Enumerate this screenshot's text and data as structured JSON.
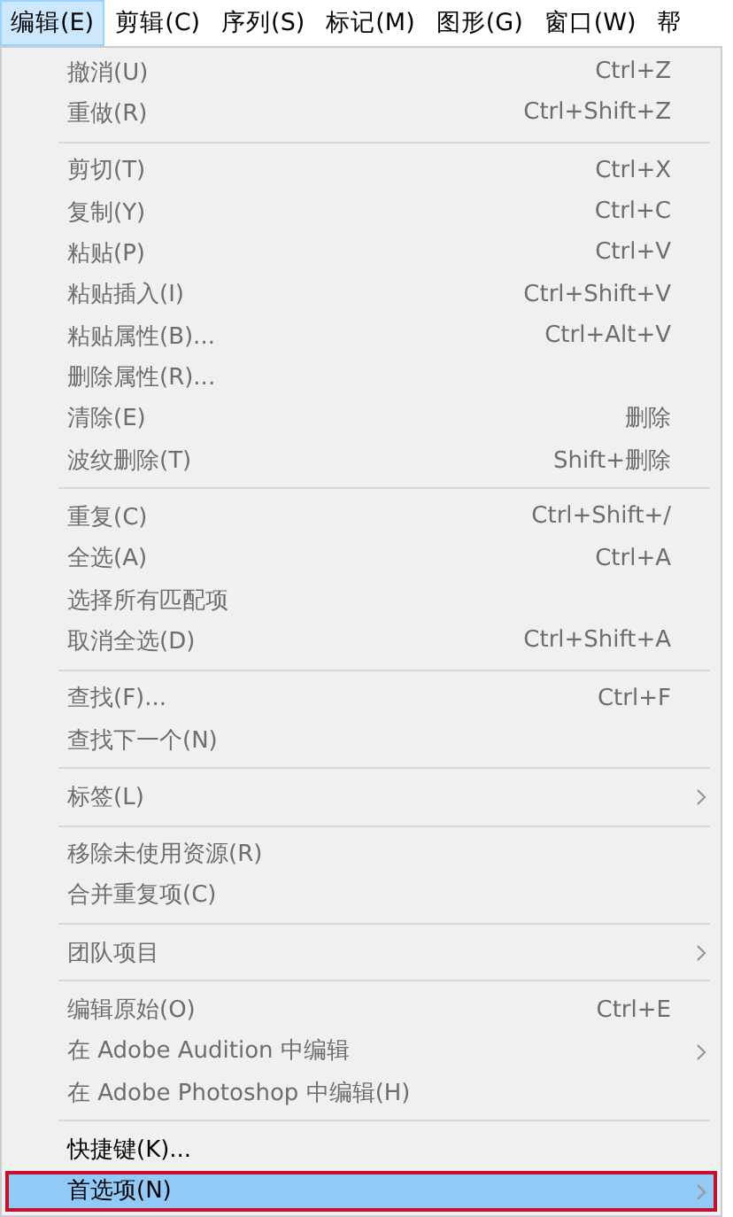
{
  "menu_bar": [
    {
      "label": "编辑(E)",
      "selected": true
    },
    {
      "label": "剪辑(C)",
      "selected": false
    },
    {
      "label": "序列(S)",
      "selected": false
    },
    {
      "label": "标记(M)",
      "selected": false
    },
    {
      "label": "图形(G)",
      "selected": false
    },
    {
      "label": "窗口(W)",
      "selected": false
    },
    {
      "label": "帮",
      "selected": false
    }
  ],
  "menu": {
    "groups": [
      {
        "items": [
          {
            "label": "撤消(U)",
            "shortcut": "Ctrl+Z",
            "disabled": true,
            "submenu": false,
            "selected": false
          },
          {
            "label": "重做(R)",
            "shortcut": "Ctrl+Shift+Z",
            "disabled": true,
            "submenu": false,
            "selected": false
          }
        ]
      },
      {
        "items": [
          {
            "label": "剪切(T)",
            "shortcut": "Ctrl+X",
            "disabled": true,
            "submenu": false,
            "selected": false
          },
          {
            "label": "复制(Y)",
            "shortcut": "Ctrl+C",
            "disabled": true,
            "submenu": false,
            "selected": false
          },
          {
            "label": "粘贴(P)",
            "shortcut": "Ctrl+V",
            "disabled": true,
            "submenu": false,
            "selected": false
          },
          {
            "label": "粘贴插入(I)",
            "shortcut": "Ctrl+Shift+V",
            "disabled": true,
            "submenu": false,
            "selected": false
          },
          {
            "label": "粘贴属性(B)...",
            "shortcut": "Ctrl+Alt+V",
            "disabled": true,
            "submenu": false,
            "selected": false
          },
          {
            "label": "删除属性(R)...",
            "disabled": true,
            "submenu": false,
            "selected": false
          },
          {
            "label": "清除(E)",
            "shortcut": "删除",
            "disabled": true,
            "submenu": false,
            "selected": false
          },
          {
            "label": "波纹删除(T)",
            "shortcut": "Shift+删除",
            "disabled": true,
            "submenu": false,
            "selected": false
          }
        ]
      },
      {
        "items": [
          {
            "label": "重复(C)",
            "shortcut": "Ctrl+Shift+/",
            "disabled": true,
            "submenu": false,
            "selected": false
          },
          {
            "label": "全选(A)",
            "shortcut": "Ctrl+A",
            "disabled": true,
            "submenu": false,
            "selected": false
          },
          {
            "label": "选择所有匹配项",
            "disabled": true,
            "submenu": false,
            "selected": false
          },
          {
            "label": "取消全选(D)",
            "shortcut": "Ctrl+Shift+A",
            "disabled": true,
            "submenu": false,
            "selected": false
          }
        ]
      },
      {
        "items": [
          {
            "label": "查找(F)...",
            "shortcut": "Ctrl+F",
            "disabled": true,
            "submenu": false,
            "selected": false
          },
          {
            "label": "查找下一个(N)",
            "disabled": true,
            "submenu": false,
            "selected": false
          }
        ]
      },
      {
        "items": [
          {
            "label": "标签(L)",
            "disabled": true,
            "submenu": true,
            "selected": false
          }
        ]
      },
      {
        "items": [
          {
            "label": "移除未使用资源(R)",
            "disabled": true,
            "submenu": false,
            "selected": false
          },
          {
            "label": "合并重复项(C)",
            "disabled": true,
            "submenu": false,
            "selected": false
          }
        ]
      },
      {
        "items": [
          {
            "label": "团队项目",
            "disabled": true,
            "submenu": true,
            "selected": false
          }
        ]
      },
      {
        "items": [
          {
            "label": "编辑原始(O)",
            "shortcut": "Ctrl+E",
            "disabled": true,
            "submenu": false,
            "selected": false
          },
          {
            "label": "在 Adobe Audition 中编辑",
            "disabled": true,
            "submenu": true,
            "selected": false
          },
          {
            "label": "在 Adobe Photoshop 中编辑(H)",
            "disabled": true,
            "submenu": false,
            "selected": false
          }
        ]
      },
      {
        "items": [
          {
            "label": "快捷键(K)...",
            "disabled": false,
            "submenu": false,
            "selected": false
          },
          {
            "label": "首选项(N)",
            "disabled": false,
            "submenu": true,
            "selected": true,
            "outlined": true
          }
        ]
      }
    ]
  }
}
